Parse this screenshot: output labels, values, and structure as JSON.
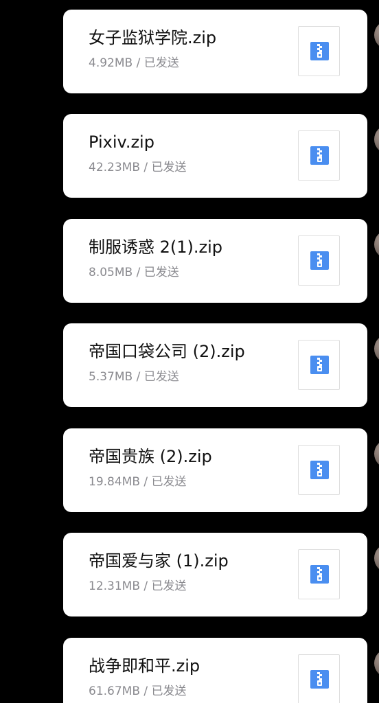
{
  "colors": {
    "background": "#000000",
    "bubble": "#ffffff",
    "file_name": "#111111",
    "file_meta": "#8a8a8f",
    "zip_icon": "#4a8ef0"
  },
  "messages": [
    {
      "file_name": "女子监狱学院.zip",
      "size": "4.92MB",
      "status": "已发送",
      "icon": "zip-archive-icon"
    },
    {
      "file_name": "Pixiv.zip",
      "size": "42.23MB",
      "status": "已发送",
      "icon": "zip-archive-icon"
    },
    {
      "file_name": "制服诱惑 2(1).zip",
      "size": "8.05MB",
      "status": "已发送",
      "icon": "zip-archive-icon"
    },
    {
      "file_name": "帝国口袋公司 (2).zip",
      "size": "5.37MB",
      "status": "已发送",
      "icon": "zip-archive-icon"
    },
    {
      "file_name": "帝国贵族 (2).zip",
      "size": "19.84MB",
      "status": "已发送",
      "icon": "zip-archive-icon"
    },
    {
      "file_name": "帝国爱与家 (1).zip",
      "size": "12.31MB",
      "status": "已发送",
      "icon": "zip-archive-icon"
    },
    {
      "file_name": "战争即和平.zip",
      "size": "61.67MB",
      "status": "已发送",
      "icon": "zip-archive-icon"
    }
  ]
}
